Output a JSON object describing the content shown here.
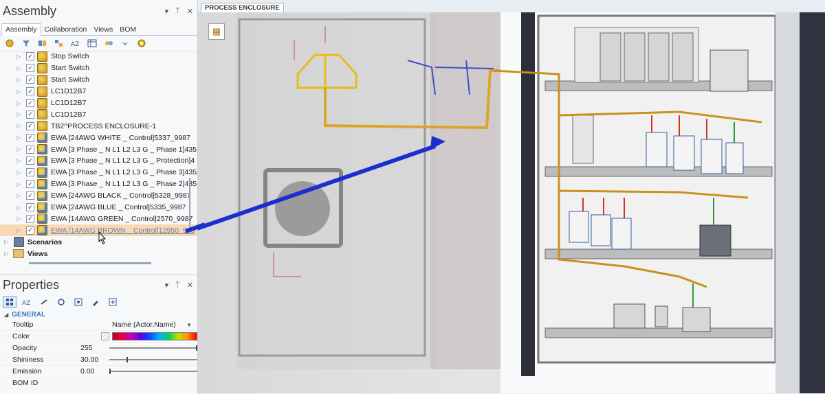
{
  "assembly": {
    "title": "Assembly",
    "tabs": [
      "Assembly",
      "Collaboration",
      "Views",
      "BOM"
    ],
    "controls": {
      "dropdown": "▾",
      "pin": "ᛘ",
      "close": "✕"
    },
    "tree_items": [
      "Stop Switch",
      "Start Switch",
      "Start Switch",
      "LC1D12B7",
      "LC1D12B7",
      "LC1D12B7",
      "TB2^PROCESS ENCLOSURE-1",
      "EWA [24AWG WHITE _ Control]5337_9987",
      "EWA [3 Phase _ N L1 L2 L3 G _ Phase 1]435",
      "EWA [3 Phase _ N L1 L2 L3 G _ Protection]4",
      "EWA [3 Phase _ N L1 L2 L3 G _ Phase 3]435",
      "EWA [3 Phase _ N L1 L2 L3 G _ Phase 2]435",
      "EWA [24AWG BLACK _ Control]5328_9987",
      "EWA [24AWG BLUE _ Control]5335_9987",
      "EWA [14AWG GREEN _ Control]2570_9987",
      "EWA [14AWG BROWN _ Control]12950_998"
    ],
    "groups": [
      "Scenarios",
      "Views"
    ]
  },
  "properties": {
    "title": "Properties",
    "section": "GENERAL",
    "rows": [
      {
        "key": "Tooltip",
        "value": "Name (Actor.Name)"
      },
      {
        "key": "Color",
        "value": ""
      },
      {
        "key": "Opacity",
        "value": "255"
      },
      {
        "key": "Shininess",
        "value": "30.00"
      },
      {
        "key": "Emission",
        "value": "0.00"
      },
      {
        "key": "BOM ID",
        "value": ""
      }
    ],
    "levels": {
      "opacity": 1.0,
      "shininess": 0.2,
      "emission": 0.0
    }
  },
  "viewer": {
    "doc_tab": "PROCESS ENCLOSURE"
  },
  "colors": {
    "accent": "#3a78b8",
    "selection": "#f8d9b4",
    "arrow": "#1a2fd0",
    "wire_bundle": "#d9a628"
  }
}
